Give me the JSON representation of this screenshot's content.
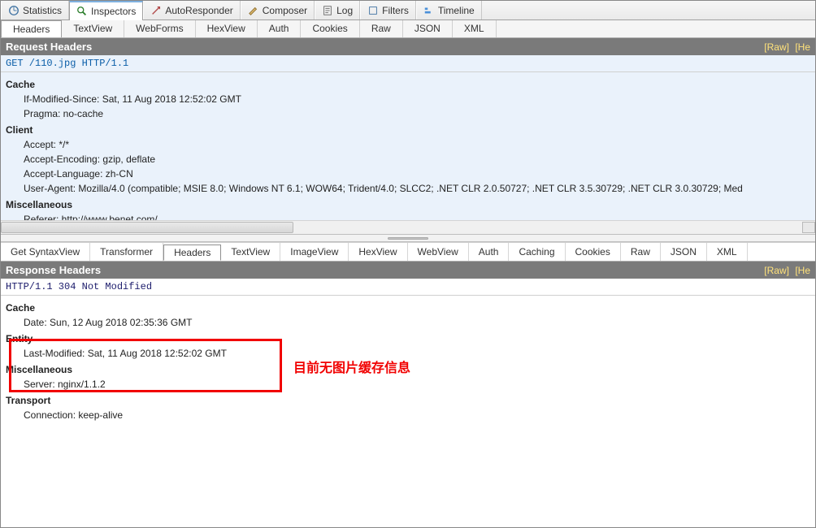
{
  "mainTabs": {
    "statistics": "Statistics",
    "inspectors": "Inspectors",
    "autoresponder": "AutoResponder",
    "composer": "Composer",
    "log": "Log",
    "filters": "Filters",
    "timeline": "Timeline"
  },
  "reqSubTabs": {
    "headers": "Headers",
    "textview": "TextView",
    "webforms": "WebForms",
    "hexview": "HexView",
    "auth": "Auth",
    "cookies": "Cookies",
    "raw": "Raw",
    "json": "JSON",
    "xml": "XML"
  },
  "requestHeader": {
    "title": "Request Headers",
    "rawLink": "[Raw]",
    "headerDefs": "[He",
    "requestLine": "GET /110.jpg HTTP/1.1"
  },
  "reqGroups": {
    "cache": "Cache",
    "cache_ifmod": "If-Modified-Since: Sat, 11 Aug 2018 12:52:02 GMT",
    "cache_pragma": "Pragma: no-cache",
    "client": "Client",
    "client_accept": "Accept: */*",
    "client_enc": "Accept-Encoding: gzip, deflate",
    "client_lang": "Accept-Language: zh-CN",
    "client_ua": "User-Agent: Mozilla/4.0 (compatible; MSIE 8.0; Windows NT 6.1; WOW64; Trident/4.0; SLCC2; .NET CLR 2.0.50727; .NET CLR 3.5.30729; .NET CLR 3.0.30729; Med",
    "misc": "Miscellaneous",
    "misc_referer": "Referer: http://www.benet.com/"
  },
  "respTabs": {
    "getsyntax": "Get SyntaxView",
    "transformer": "Transformer",
    "headers": "Headers",
    "textview": "TextView",
    "imageview": "ImageView",
    "hexview": "HexView",
    "webview": "WebView",
    "auth": "Auth",
    "caching": "Caching",
    "cookies": "Cookies",
    "raw": "Raw",
    "json": "JSON",
    "xml": "XML"
  },
  "responseHeader": {
    "title": "Response Headers",
    "rawLink": "[Raw]",
    "headerDefs": "[He",
    "statusLine": "HTTP/1.1 304 Not Modified"
  },
  "respGroups": {
    "cache": "Cache",
    "cache_date": "Date: Sun, 12 Aug 2018 02:35:36 GMT",
    "entity": "Entity",
    "entity_lm": "Last-Modified: Sat, 11 Aug 2018 12:52:02 GMT",
    "misc": "Miscellaneous",
    "misc_server": "Server: nginx/1.1.2",
    "transport": "Transport",
    "transport_conn": "Connection: keep-alive"
  },
  "annotation": "目前无图片缓存信息"
}
